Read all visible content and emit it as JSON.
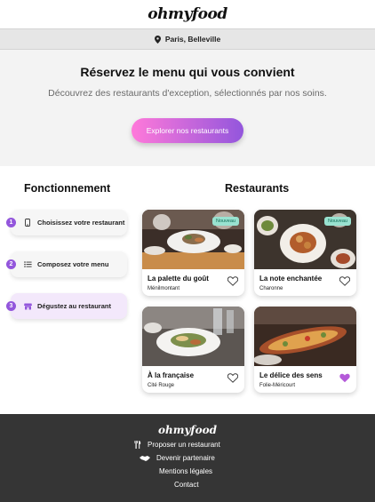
{
  "brand": {
    "logo": "ohmyfood"
  },
  "location": {
    "label": "Paris, Belleville"
  },
  "hero": {
    "title": "Réservez le menu qui vous convient",
    "subtitle": "Découvrez des restaurants d'exception, sélectionnés par nos soins.",
    "cta": "Explorer nos restaurants"
  },
  "sections": {
    "how": "Fonctionnement",
    "restaurants": "Restaurants"
  },
  "steps": [
    {
      "num": "1",
      "label": "Choisissez votre restaurant",
      "icon": "phone-icon"
    },
    {
      "num": "2",
      "label": "Composez votre menu",
      "icon": "list-icon"
    },
    {
      "num": "3",
      "label": "Dégustez au restaurant",
      "icon": "store-icon"
    }
  ],
  "restaurants": [
    {
      "name": "La palette du goût",
      "area": "Ménilmontant",
      "badge": "Nouveau",
      "liked": false
    },
    {
      "name": "La note enchantée",
      "area": "Charonne",
      "badge": "Nouveau",
      "liked": false
    },
    {
      "name": "À la française",
      "area": "Cité Rouge",
      "badge": "",
      "liked": false
    },
    {
      "name": "Le délice des sens",
      "area": "Folie-Méricourt",
      "badge": "",
      "liked": true
    }
  ],
  "footer": {
    "logo": "ohmyfood",
    "links": [
      {
        "label": "Proposer un restaurant",
        "icon": "utensils-icon"
      },
      {
        "label": "Devenir partenaire",
        "icon": "handshake-icon"
      },
      {
        "label": "Mentions légales",
        "icon": ""
      },
      {
        "label": "Contact",
        "icon": ""
      }
    ]
  },
  "colors": {
    "accent": "#9356dc",
    "accent_pink": "#ff79da",
    "badge_bg": "#99e2d0",
    "footer_bg": "#353535"
  }
}
